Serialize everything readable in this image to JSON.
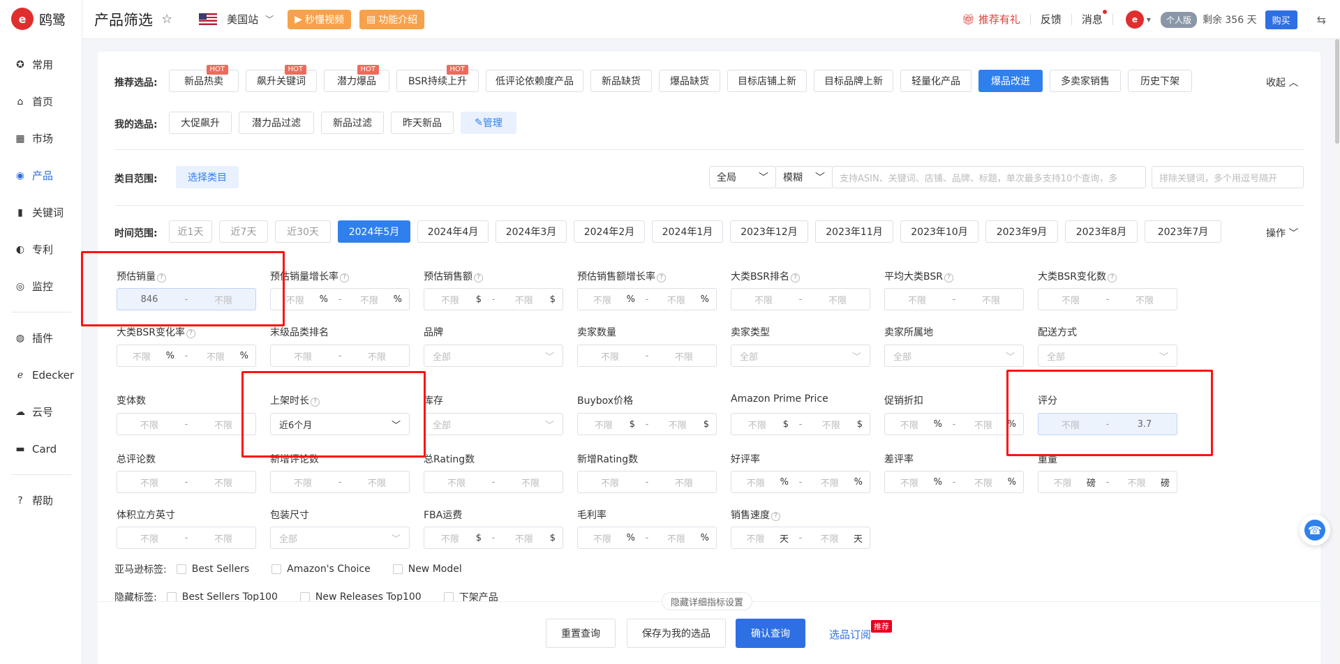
{
  "brand": {
    "logo_letter": "e",
    "name": "鸥鹭"
  },
  "sidebar": {
    "items": [
      {
        "label": "常用",
        "icon": "star-circle-icon",
        "glyph": "✪"
      },
      {
        "label": "首页",
        "icon": "home-icon",
        "glyph": "⌂"
      },
      {
        "label": "市场",
        "icon": "market-icon",
        "glyph": "▦"
      },
      {
        "label": "产品",
        "icon": "product-eye-icon",
        "glyph": "◉"
      },
      {
        "label": "关键词",
        "icon": "keyword-chart-icon",
        "glyph": "▮"
      },
      {
        "label": "专利",
        "icon": "patent-icon",
        "glyph": "◐"
      },
      {
        "label": "监控",
        "icon": "monitor-icon",
        "glyph": "◎"
      },
      {
        "label": "插件",
        "icon": "chrome-plugin-icon",
        "glyph": "◍"
      },
      {
        "label": "Edecker",
        "icon": "edecker-icon",
        "glyph": "ℯ"
      },
      {
        "label": "云号",
        "icon": "cloud-icon",
        "glyph": "☁"
      },
      {
        "label": "Card",
        "icon": "card-icon",
        "glyph": "▬"
      },
      {
        "label": "帮助",
        "icon": "help-icon",
        "glyph": "?"
      }
    ],
    "active_index": 3
  },
  "header": {
    "title": "产品筛选",
    "site": "美国站",
    "video_btn": "秒懂视频",
    "intro_btn": "功能介绍",
    "referral": "推荐有礼",
    "feedback": "反馈",
    "messages": "消息",
    "plan": "个人版",
    "remaining": "剩余 356 天",
    "buy": "购买"
  },
  "recommend": {
    "label": "推荐选品:",
    "hot_badge": "HOT",
    "chips": [
      "新品热卖",
      "飙升关键词",
      "潜力爆品",
      "BSR持续上升",
      "低评论依赖度产品",
      "新品缺货",
      "爆品缺货",
      "目标店铺上新",
      "目标品牌上新",
      "轻量化产品",
      "爆品改进",
      "多卖家销售",
      "历史下架"
    ],
    "active": "爆品改进",
    "collapse": "收起"
  },
  "mine": {
    "label": "我的选品:",
    "chips": [
      "大促飙升",
      "潜力品过滤",
      "新品过滤",
      "昨天新品"
    ],
    "manage": "管理"
  },
  "category": {
    "label": "类目范围:",
    "select_btn": "选择类目",
    "scope": "全局",
    "match": "模糊",
    "search_placeholder": "支持ASIN、关键词、店铺、品牌、标题，单次最多支持10个查询，多",
    "exclude_placeholder": "排除关键词，多个用逗号隔开"
  },
  "time": {
    "label": "时间范围:",
    "chips": [
      "近1天",
      "近7天",
      "近30天",
      "2024年5月",
      "2024年4月",
      "2024年3月",
      "2024年2月",
      "2024年1月",
      "2023年12月",
      "2023年11月",
      "2023年10月",
      "2023年9月",
      "2023年8月",
      "2023年7月"
    ],
    "active": "2024年5月",
    "ops": "操作"
  },
  "filters": {
    "unlimited": "不限",
    "all": "全部",
    "dash": "-",
    "row1": [
      {
        "label": "预估销量",
        "min": "846",
        "max": "不限",
        "unit": ""
      },
      {
        "label": "预估销量增长率",
        "min": "不限",
        "max": "不限",
        "unit": "%"
      },
      {
        "label": "预估销售额",
        "min": "不限",
        "max": "不限",
        "unit": "$"
      },
      {
        "label": "预估销售额增长率",
        "min": "不限",
        "max": "不限",
        "unit": "%"
      },
      {
        "label": "大类BSR排名",
        "min": "不限",
        "max": "不限",
        "unit": ""
      },
      {
        "label": "平均大类BSR",
        "min": "不限",
        "max": "不限",
        "unit": ""
      },
      {
        "label": "大类BSR变化数",
        "min": "不限",
        "max": "不限",
        "unit": ""
      }
    ],
    "row2": [
      {
        "label": "大类BSR变化率",
        "kind": "range",
        "unit": "%"
      },
      {
        "label": "末级品类排名",
        "kind": "range",
        "unit": ""
      },
      {
        "label": "品牌",
        "kind": "select"
      },
      {
        "label": "卖家数量",
        "kind": "range",
        "unit": ""
      },
      {
        "label": "卖家类型",
        "kind": "select"
      },
      {
        "label": "卖家所属地",
        "kind": "select"
      },
      {
        "label": "配送方式",
        "kind": "select"
      }
    ],
    "row3": [
      {
        "label": "变体数",
        "kind": "range",
        "unit": ""
      },
      {
        "label": "上架时长",
        "kind": "select",
        "value": "近6个月"
      },
      {
        "label": "库存",
        "kind": "select"
      },
      {
        "label": "Buybox价格",
        "kind": "range",
        "unit": "$"
      },
      {
        "label": "Amazon Prime Price",
        "kind": "range",
        "unit": "$"
      },
      {
        "label": "促销折扣",
        "kind": "range",
        "unit": "%"
      },
      {
        "label": "评分",
        "kind": "range",
        "unit": "",
        "min": "不限",
        "max": "3.7"
      }
    ],
    "row4": [
      {
        "label": "总评论数",
        "unit": ""
      },
      {
        "label": "新增评论数",
        "unit": ""
      },
      {
        "label": "总Rating数",
        "unit": ""
      },
      {
        "label": "新增Rating数",
        "unit": ""
      },
      {
        "label": "好评率",
        "unit": "%"
      },
      {
        "label": "差评率",
        "unit": "%"
      },
      {
        "label": "重量",
        "unit": "磅"
      }
    ],
    "row5": [
      {
        "label": "体积立方英寸",
        "kind": "range",
        "unit": ""
      },
      {
        "label": "包装尺寸",
        "kind": "select"
      },
      {
        "label": "FBA运费",
        "kind": "range",
        "unit": "$"
      },
      {
        "label": "毛利率",
        "kind": "range",
        "unit": "%"
      },
      {
        "label": "销售速度",
        "kind": "range",
        "unit": "天"
      }
    ],
    "amazon_tags_label": "亚马逊标签:",
    "amazon_tags": [
      "Best Sellers",
      "Amazon's Choice",
      "New Model"
    ],
    "hidden_tags_label": "隐藏标签:",
    "hidden_tags": [
      "Best Sellers Top100",
      "New Releases Top100",
      "下架产品"
    ],
    "hide_detail": "隐藏详细指标设置"
  },
  "actions": {
    "reset": "重置查询",
    "save": "保存为我的选品",
    "confirm": "确认查询",
    "subscribe": "选品订阅",
    "recommend_badge": "推荐"
  }
}
